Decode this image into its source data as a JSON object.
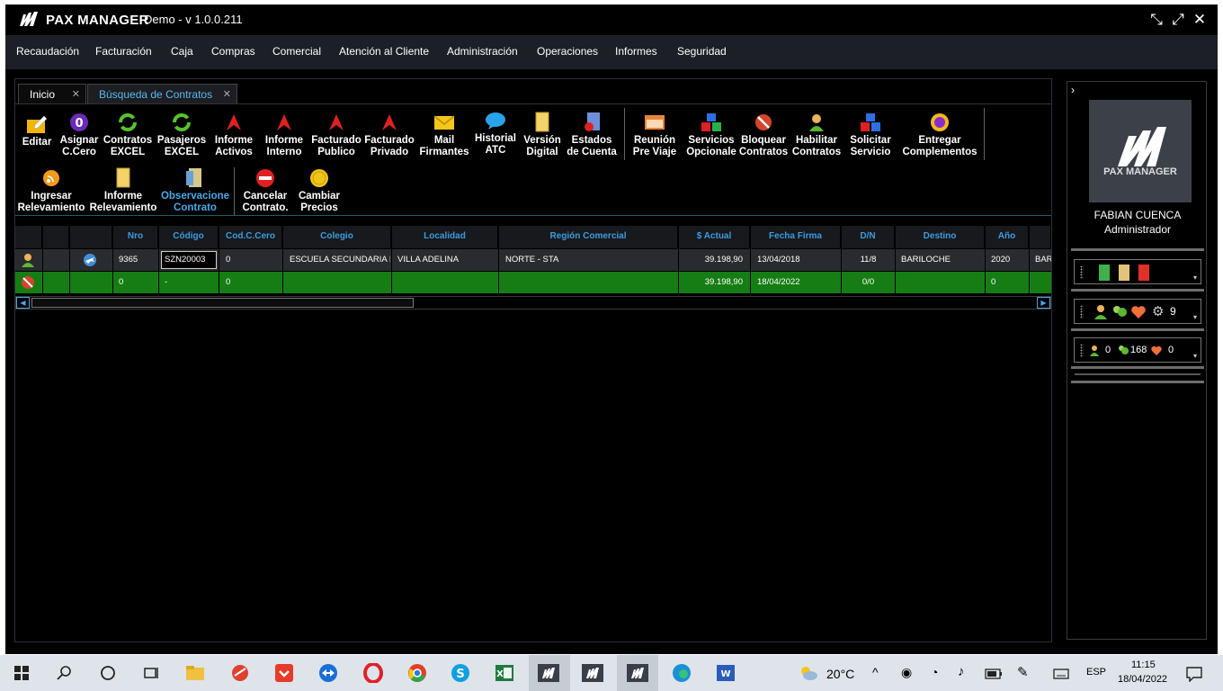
{
  "app": {
    "brand": "PAX MANAGER",
    "version": "Demo - v 1.0.0.211"
  },
  "menu": [
    "Recaudación",
    "Facturación",
    "Caja",
    "Compras",
    "Comercial",
    "Atención al Cliente",
    "Administración",
    "Operaciones",
    "Informes",
    "Seguridad"
  ],
  "tabs": [
    {
      "label": "Inicio"
    },
    {
      "label": "Búsqueda de Contratos"
    }
  ],
  "toolbar_row1": [
    {
      "l1": "",
      "l2": "Editar"
    },
    {
      "l1": "Asignar",
      "l2": "C.Cero"
    },
    {
      "l1": "Contratos",
      "l2": "EXCEL"
    },
    {
      "l1": "Pasajeros",
      "l2": "EXCEL"
    },
    {
      "l1": "Informe",
      "l2": "Activos"
    },
    {
      "l1": "Informe",
      "l2": "Interno"
    },
    {
      "l1": "Facturado",
      "l2": "Publico"
    },
    {
      "l1": "Facturado",
      "l2": "Privado"
    },
    {
      "l1": "Mail",
      "l2": "Firmantes"
    },
    {
      "l1": "Historial",
      "l2": "ATC"
    },
    {
      "l1": "Versión",
      "l2": "Digital"
    },
    {
      "l1": "Estados",
      "l2": "de Cuenta"
    },
    {
      "l1": "Reunión",
      "l2": "Pre Viaje"
    },
    {
      "l1": "Servicios",
      "l2": "Opcionale"
    },
    {
      "l1": "Bloquear",
      "l2": "Contratos"
    },
    {
      "l1": "Habilitar",
      "l2": "Contratos"
    },
    {
      "l1": "Solicitar",
      "l2": "Servicio"
    },
    {
      "l1": "Entregar",
      "l2": "Complementos"
    }
  ],
  "toolbar_row2": [
    {
      "l1": "Ingresar",
      "l2": "Relevamiento"
    },
    {
      "l1": "Informe",
      "l2": "Relevamiento"
    },
    {
      "l1": "Observacione",
      "l2": "Contrato"
    },
    {
      "l1": "Cancelar",
      "l2": "Contrato."
    },
    {
      "l1": "Cambiar",
      "l2": "Precios"
    }
  ],
  "grid": {
    "headers": [
      "Nro",
      "Código",
      "Cod.C.Cero",
      "Colegio",
      "Localidad",
      "Región Comercial",
      "$ Actual",
      "Fecha Firma",
      "D/N",
      "Destino",
      "Año"
    ],
    "row1": {
      "nro": "9365",
      "codigo": "SZN20003",
      "codccero": "0",
      "colegio": "ESCUELA SECUNDARIA I",
      "localidad": "VILLA ADELINA",
      "region": "NORTE - STA",
      "actual": "39.198,90",
      "fecha": "13/04/2018",
      "dn": "11/8",
      "destino": "BARILOCHE",
      "anio": "2020",
      "extra": "BAR"
    },
    "row2": {
      "nro": "0",
      "codigo": "-",
      "codccero": "0",
      "actual": "39.198,90",
      "fecha": "18/04/2022",
      "dn": "0/0",
      "anio": "0"
    }
  },
  "side": {
    "logo_text": "PAX MANAGER",
    "user_name": "FABIAN CUENCA",
    "user_role": "Administrador",
    "group_count": "9",
    "count_a": "0",
    "count_b": "168",
    "count_c": "0"
  },
  "taskbar": {
    "weather": "20°C",
    "lang": "ESP",
    "time": "11:15",
    "date": "18/04/2022"
  }
}
